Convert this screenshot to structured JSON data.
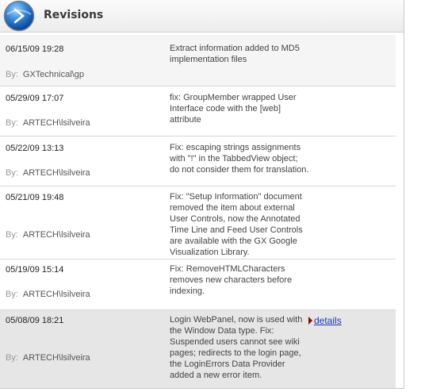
{
  "header": {
    "title": "Revisions"
  },
  "colors": {
    "link": "#1a36b8",
    "header_bg": "#ececec"
  },
  "by_label": "By:",
  "revisions": [
    {
      "date": "06/15/09 19:28",
      "user": "GXTechnical\\gp",
      "message": "Extract information added to MD5 implementation files"
    },
    {
      "date": "05/29/09 17:07",
      "user": "ARTECH\\lsilveira",
      "message": "fix: GroupMember wrapped User Interface code with the [web] attribute"
    },
    {
      "date": "05/22/09 13:13",
      "user": "ARTECH\\lsilveira",
      "message": "Fix: escaping strings assignments with \"!\" in the TabbedView object; do not consider them for translation."
    },
    {
      "date": "05/21/09 19:48",
      "user": "ARTECH\\lsilveira",
      "message": "Fix: \"Setup Information\" document removed the item about external User Controls, now the Annotated Time Line and Feed User Controls are available with the GX Google Visualization Library."
    },
    {
      "date": "05/19/09 15:14",
      "user": "ARTECH\\lsilveira",
      "message": "Fix: RemoveHTMLCharacters removes new characters before indexing."
    },
    {
      "date": "05/08/09 18:21",
      "user": "ARTECH\\lsilveira",
      "message": "Login WebPanel, now is used with the Window Data type. Fix: Suspended users cannot see wiki pages; redirects to the login page, the LoginErrors Data Provider added a new error item.",
      "details_label": "details"
    }
  ]
}
